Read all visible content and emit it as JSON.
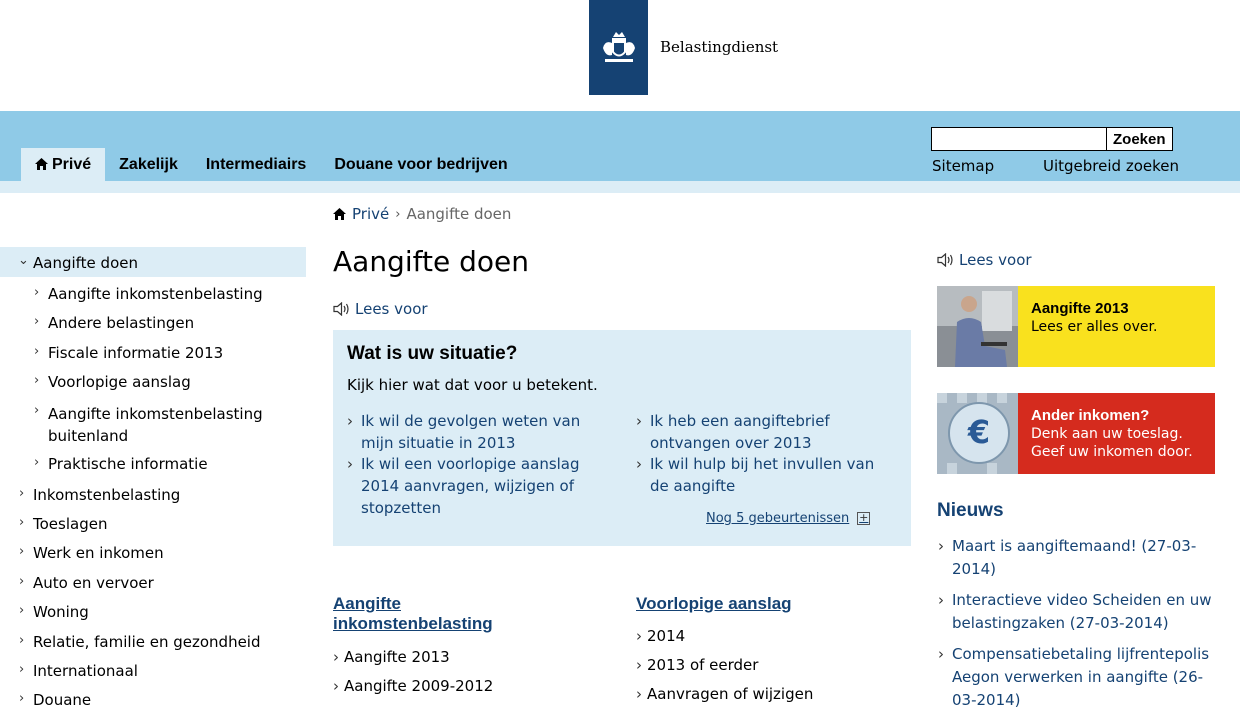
{
  "header": {
    "logo_text": "Belastingdienst"
  },
  "nav": {
    "tabs": [
      {
        "label": "Privé"
      },
      {
        "label": "Zakelijk"
      },
      {
        "label": "Intermediairs"
      },
      {
        "label": "Douane voor bedrijven"
      }
    ],
    "search_button": "Zoeken",
    "search_value": "",
    "sitemap": "Sitemap",
    "advanced_search": "Uitgebreid zoeken"
  },
  "breadcrumb": {
    "home": "Privé",
    "current": "Aangifte doen"
  },
  "sidebar": {
    "items": [
      {
        "label": "Aangifte doen"
      },
      {
        "label": "Aangifte inkomstenbelasting"
      },
      {
        "label": "Andere belastingen"
      },
      {
        "label": "Fiscale informatie 2013"
      },
      {
        "label": "Voorlopige aanslag"
      },
      {
        "label": "Aangifte inkomstenbelasting buitenland"
      },
      {
        "label": "Praktische informatie"
      },
      {
        "label": "Inkomstenbelasting"
      },
      {
        "label": "Toeslagen"
      },
      {
        "label": "Werk en inkomen"
      },
      {
        "label": "Auto en vervoer"
      },
      {
        "label": "Woning"
      },
      {
        "label": "Relatie, familie en gezondheid"
      },
      {
        "label": "Internationaal"
      },
      {
        "label": "Douane"
      }
    ]
  },
  "main": {
    "title": "Aangifte doen",
    "lees_voor": "Lees voor",
    "situation": {
      "title": "Wat is uw situatie?",
      "subtitle": "Kijk hier wat dat voor u betekent.",
      "links": [
        "Ik wil de gevolgen weten van mijn situatie in 2013",
        "Ik wil een voorlopige aanslag 2014 aanvragen, wijzigen of stopzetten",
        "Ik heb een aangiftebrief ontvangen over 2013",
        "Ik wil hulp bij het invullen van de aangifte"
      ],
      "more": "Nog 5 gebeurtenissen",
      "more_symbol": "+"
    },
    "col1": {
      "heading": "Aangifte inkomstenbelasting",
      "links": [
        "Aangifte 2013",
        "Aangifte 2009-2012"
      ]
    },
    "col2": {
      "heading": "Voorlopige aanslag",
      "links": [
        "2014",
        "2013 of eerder",
        "Aanvragen of wijzigen"
      ]
    }
  },
  "right": {
    "lees_voor": "Lees voor",
    "banner1": {
      "title": "Aangifte 2013",
      "text": "Lees er alles over.",
      "bg": "#f9e11e"
    },
    "banner2": {
      "title": "Ander inkomen?",
      "line1": "Denk aan uw toeslag.",
      "line2": "Geef uw inkomen door.",
      "bg": "#d52b1e"
    },
    "news_heading": "Nieuws",
    "news": [
      "Maart is aangiftemaand! (27-03-2014)",
      "Interactieve video Scheiden en uw belastingzaken (27-03-2014)",
      "Compensatiebetaling lijfrentepolis Aegon verwerken in aangifte (26-03-2014)"
    ]
  },
  "colors": {
    "brand": "#154273",
    "nav_bg": "#8fcae7",
    "light_blue": "#dcedf6"
  }
}
